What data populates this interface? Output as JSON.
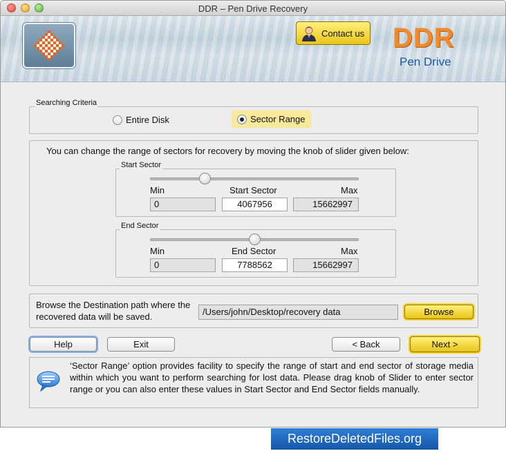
{
  "window": {
    "title": "DDR – Pen Drive Recovery"
  },
  "header": {
    "contact_label": "Contact us",
    "brand": "DDR",
    "brand_sub": "Pen Drive",
    "colors": {
      "brand": "#f08a2a",
      "brand_sub": "#1d5aa6",
      "accent_button": "#f2d52a"
    }
  },
  "criteria": {
    "legend": "Searching Criteria",
    "options": [
      {
        "label": "Entire Disk",
        "selected": false
      },
      {
        "label": "Sector Range",
        "selected": true
      }
    ]
  },
  "range": {
    "instruction": "You can change the range of sectors for recovery by moving the knob of slider given below:",
    "start": {
      "legend": "Start Sector",
      "min_label": "Min",
      "value_label": "Start Sector",
      "max_label": "Max",
      "min": "0",
      "value": "4067956",
      "max": "15662997",
      "slider_fraction": 0.26
    },
    "end": {
      "legend": "End Sector",
      "min_label": "Min",
      "value_label": "End Sector",
      "max_label": "Max",
      "min": "0",
      "value": "7788562",
      "max": "15662997",
      "slider_fraction": 0.5
    }
  },
  "destination": {
    "label": "Browse the Destination path where the recovered data will be saved.",
    "path": "/Users/john/Desktop/recovery data",
    "browse_label": "Browse"
  },
  "nav": {
    "help": "Help",
    "exit": "Exit",
    "back": "< Back",
    "next": "Next >"
  },
  "help_text": "‘Sector Range’ option provides facility to specify the range of start and end sector of storage media within which you want to perform searching for lost data. Please drag knob of Slider to enter sector range or you can also enter these values in Start Sector and End Sector fields manually.",
  "footer": {
    "badge": "RestoreDeletedFiles.org"
  },
  "icons": {
    "logo": "checker-diamond-icon",
    "contact": "person-icon",
    "help": "speech-bubble-icon"
  }
}
